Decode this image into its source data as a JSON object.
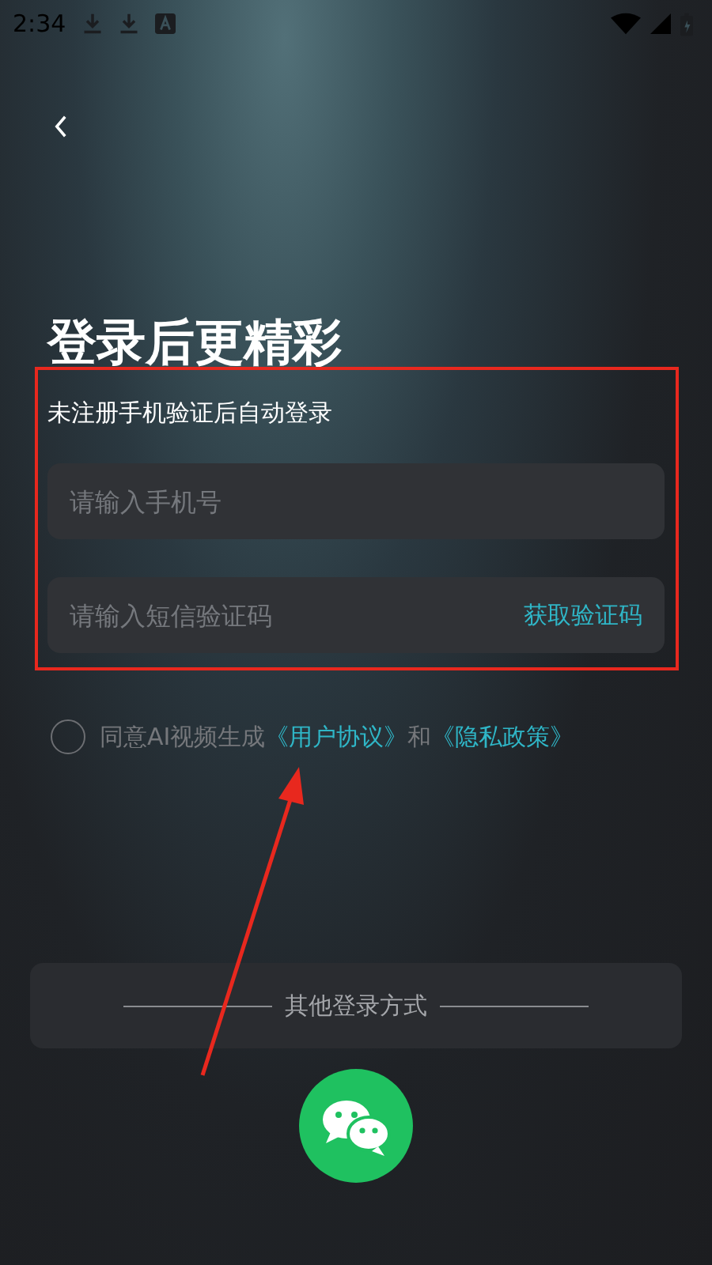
{
  "status_bar": {
    "time": "2:34"
  },
  "title": "登录后更精彩",
  "subtitle": "未注册手机验证后自动登录",
  "fields": [
    {
      "kind": "phone",
      "placeholder": "请输入手机号"
    },
    {
      "kind": "code",
      "placeholder": "请输入短信验证码",
      "action": "获取验证码"
    }
  ],
  "agreement": {
    "checked": false,
    "parts": [
      {
        "kind": "text",
        "text": "同意AI视频生成"
      },
      {
        "kind": "link",
        "text": "《用户协议》"
      },
      {
        "kind": "text",
        "text": "和"
      },
      {
        "kind": "link",
        "text": "《隐私政策》"
      }
    ]
  },
  "other_login": {
    "label": "其他登录方式"
  },
  "annotations": {
    "box": true,
    "arrow": true
  }
}
